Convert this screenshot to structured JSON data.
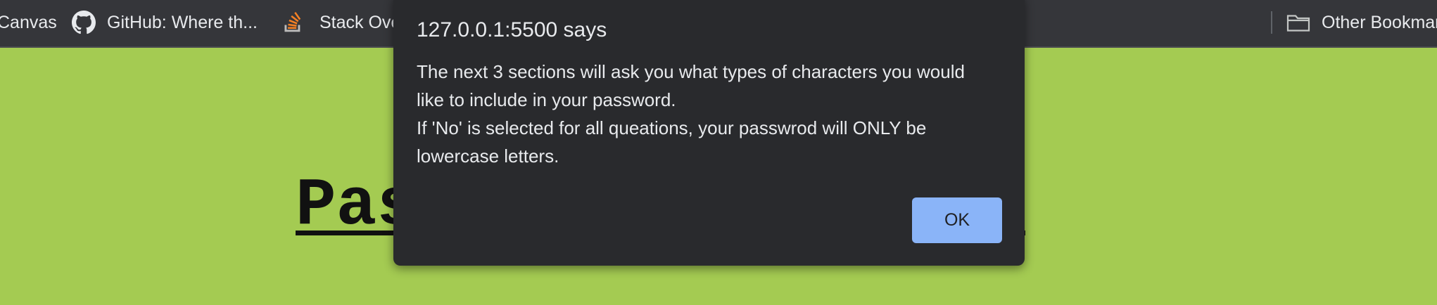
{
  "bookmarks_bar": {
    "items": [
      {
        "label": "Canvas"
      },
      {
        "label": "GitHub: Where th...",
        "icon": "github-icon"
      },
      {
        "label": "Stack Overflow",
        "icon": "stackoverflow-icon"
      }
    ],
    "other_bookmarks": {
      "label": "Other Bookmarks",
      "icon": "folder-icon"
    }
  },
  "page": {
    "title": "Password Generator"
  },
  "alert": {
    "title": "127.0.0.1:5500 says",
    "message_line1": "The next 3 sections will ask you what types of characters you would like to include in your password.",
    "message_line2": "If 'No' is selected for all queations, your passwrod will ONLY be lowercase letters.",
    "ok_label": "OK"
  },
  "colors": {
    "page_background": "#a4cb52",
    "toolbar_background": "#35363a",
    "dialog_background": "#292a2d",
    "ok_button": "#8ab4f8"
  }
}
